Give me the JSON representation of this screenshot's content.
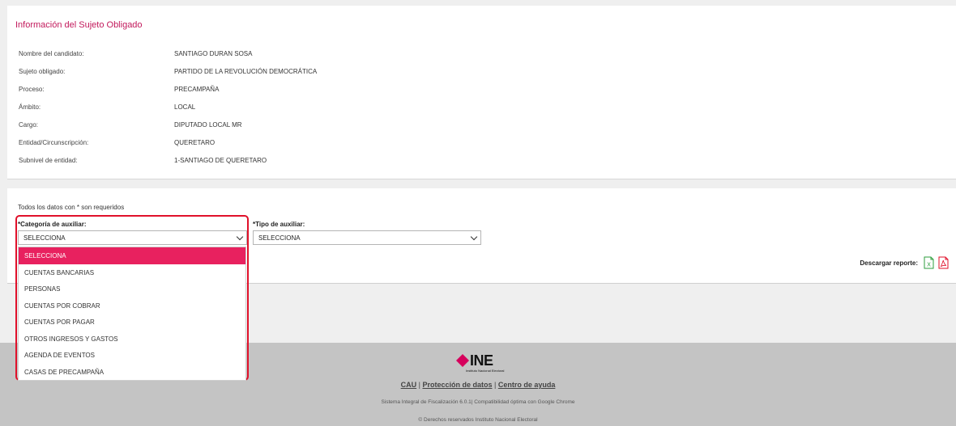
{
  "info": {
    "title": "Información del Sujeto Obligado",
    "rows": [
      {
        "label": "Nombre del candidato:",
        "value": "SANTIAGO DURAN SOSA"
      },
      {
        "label": "Sujeto obligado:",
        "value": "PARTIDO DE LA REVOLUCIÓN DEMOCRÁTICA"
      },
      {
        "label": "Proceso:",
        "value": "PRECAMPAÑA"
      },
      {
        "label": "Ámbito:",
        "value": "LOCAL"
      },
      {
        "label": "Cargo:",
        "value": "DIPUTADO LOCAL MR"
      },
      {
        "label": "Entidad/Circunscripción:",
        "value": "QUERETARO"
      },
      {
        "label": "Subnivel de entidad:",
        "value": "1-SANTIAGO DE QUERETARO"
      }
    ]
  },
  "form": {
    "required_note": "Todos los datos con * son requeridos",
    "categoria": {
      "star": "*",
      "label": "Categoría de auxiliar:",
      "value": "SELECCIONA"
    },
    "tipo": {
      "star": "*",
      "label": "Tipo de auxiliar:",
      "value": "SELECCIONA"
    },
    "download_label": "Descargar reporte:",
    "excel_icon_color": "#2e9e3e",
    "pdf_icon_color": "#e0102a"
  },
  "dropdown": {
    "highlight_color": "#e0102a",
    "selected_color": "#e8215f",
    "options": [
      "SELECCIONA",
      "CUENTAS BANCARIAS",
      "PERSONAS",
      "CUENTAS POR COBRAR",
      "CUENTAS POR PAGAR",
      "OTROS INGRESOS Y GASTOS",
      "AGENDA DE EVENTOS",
      "CASAS DE PRECAMPAÑA"
    ]
  },
  "footer": {
    "logo_text": "INE",
    "logo_sub": "Instituto Nacional Electoral",
    "logo_color": "#d6005c",
    "links": {
      "cau": "CAU",
      "sep1": " | ",
      "privacy": "Protección de datos",
      "sep2": " | ",
      "help": "Centro de ayuda"
    },
    "system_line": "Sistema Integral de Fiscalización 6.0.1| Compatibilidad óptima con Google Chrome",
    "rights_line": "© Derechos reservados Instituto Nacional Electoral"
  }
}
